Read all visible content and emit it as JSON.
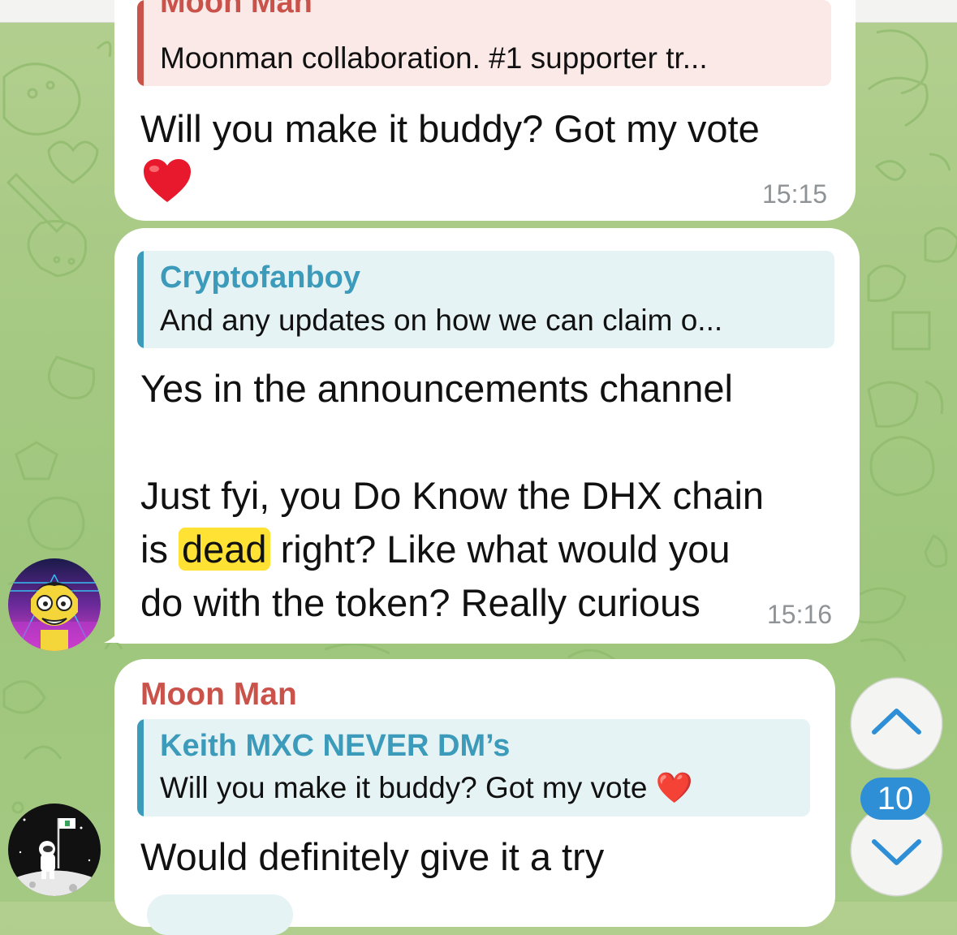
{
  "messages": [
    {
      "reply": {
        "name": "Moon Man",
        "text": "Moonman collaboration. #1 supporter tr..."
      },
      "lines": [
        "Will you make it buddy? Got my vote"
      ],
      "emoji": "❤️",
      "time": "15:15"
    },
    {
      "reply": {
        "name": "Cryptofanboy",
        "text": "And any updates on how we can claim o..."
      },
      "line1": "Yes in the announcements channel",
      "line2": "Just fyi, you Do Know the DHX chain",
      "line3_pre": "is",
      "line3_highlight": "dead",
      "line3_post": "right? Like what would you",
      "line4": "do with the token? Really curious",
      "time": "15:16"
    },
    {
      "sender": "Moon Man",
      "reply": {
        "name": "Keith MXC NEVER DM’s",
        "text": "Will you make it buddy? Got my vote ❤️"
      },
      "line1": "Would definitely give it a try"
    }
  ],
  "unread_count": "10",
  "icons": {
    "scroll_up": "chevron-up-icon",
    "scroll_down": "chevron-down-icon"
  },
  "colors": {
    "moon_man": "#c9534a",
    "reply_blue": "#3c9bbb",
    "highlight": "#ffe233",
    "badge": "#2f8fd6"
  }
}
